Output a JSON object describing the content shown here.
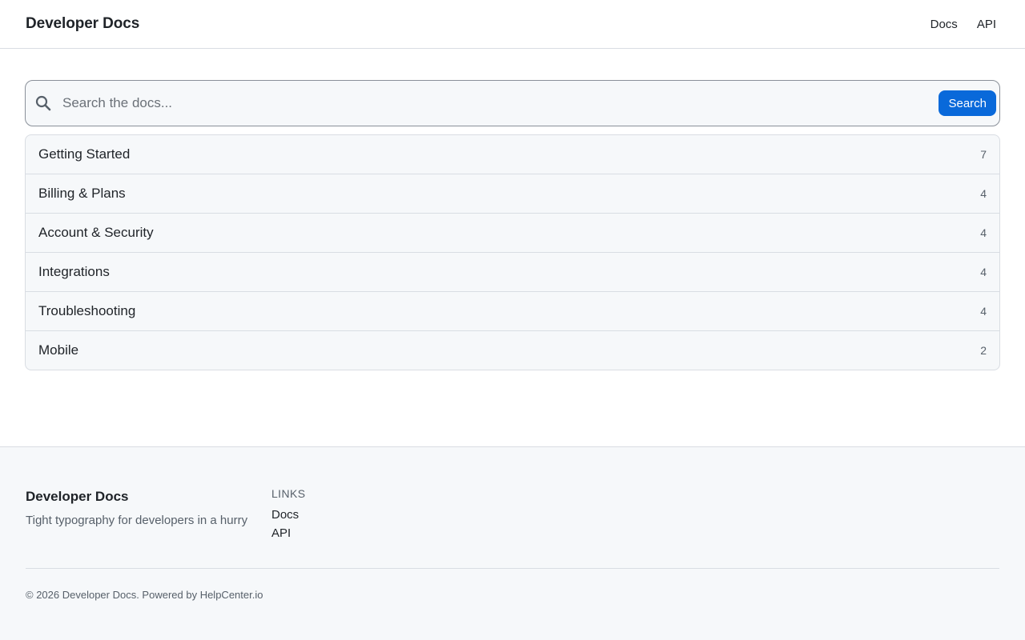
{
  "header": {
    "brand": "Developer Docs",
    "nav": [
      "Docs",
      "API"
    ]
  },
  "search": {
    "icon": "search-icon",
    "placeholder": "Search the docs...",
    "value": "",
    "button_label": "Search",
    "accent_color": "#0969da"
  },
  "categories": [
    {
      "name": "Getting Started",
      "count": "7"
    },
    {
      "name": "Billing & Plans",
      "count": "4"
    },
    {
      "name": "Account & Security",
      "count": "4"
    },
    {
      "name": "Integrations",
      "count": "4"
    },
    {
      "name": "Troubleshooting",
      "count": "4"
    },
    {
      "name": "Mobile",
      "count": "2"
    }
  ],
  "footer": {
    "brand": "Developer Docs",
    "tagline": "Tight typography for developers in a hurry",
    "links_heading": "LINKS",
    "links": [
      "Docs",
      "API"
    ],
    "copyright": "© 2026 Developer Docs. Powered by HelpCenter.io"
  }
}
